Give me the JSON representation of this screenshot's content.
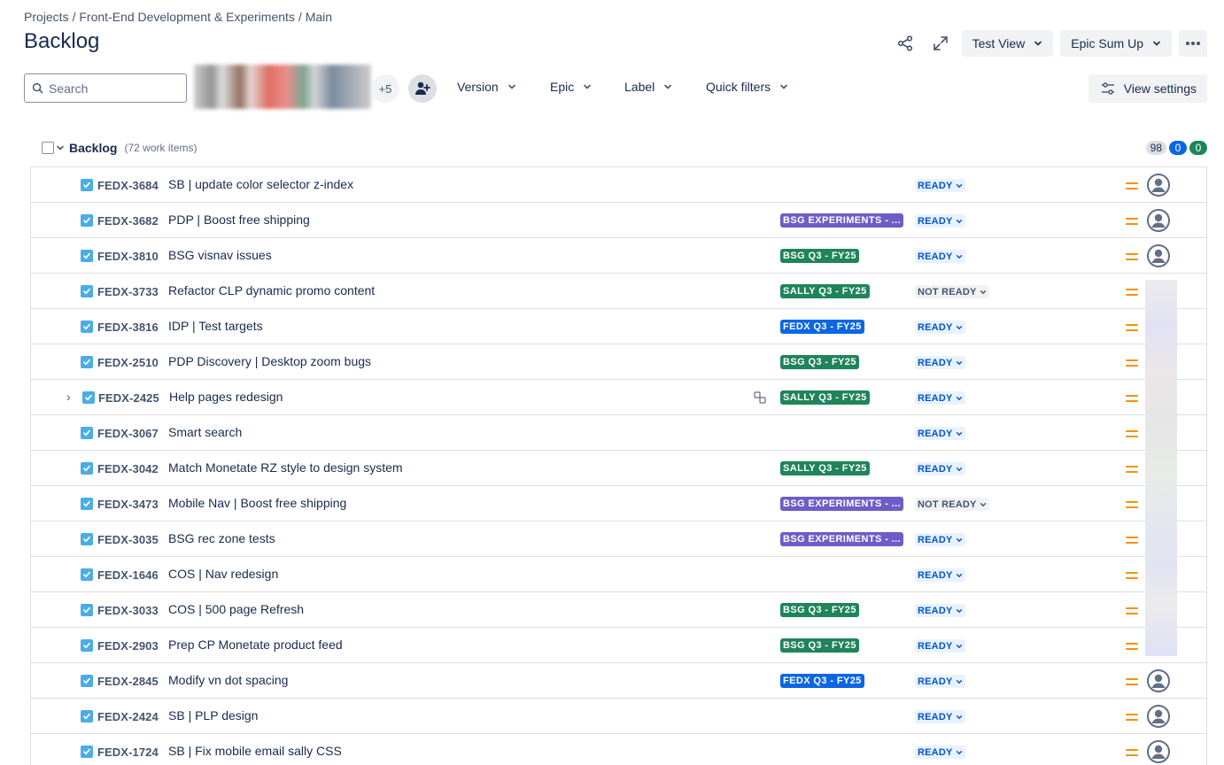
{
  "breadcrumb": [
    "Projects",
    "/ Front-End Development & Experiments",
    "/ Main"
  ],
  "title": "Backlog",
  "header": {
    "test_view": "Test View",
    "epic_sum_up": "Epic Sum Up"
  },
  "search": {
    "placeholder": "Search"
  },
  "extra_people": "+5",
  "filters": [
    "Version",
    "Epic",
    "Label",
    "Quick filters"
  ],
  "view_settings": "View settings",
  "backlog": {
    "label": "Backlog",
    "count_text": "(72 work items)",
    "counts": [
      "98",
      "0",
      "0"
    ]
  },
  "colors": {
    "purple": "#6e5dc6",
    "green": "#1f845a",
    "blue": "#0c66e4",
    "priority": "#f79009"
  },
  "rows": [
    {
      "key": "FEDX-3684",
      "summary": "SB | update color selector z-index",
      "epic": "",
      "epic_color": "",
      "status": "READY",
      "expandable": false,
      "has_children": false,
      "avatar": "person"
    },
    {
      "key": "FEDX-3682",
      "summary": "PDP | Boost free shipping",
      "epic": "BSG EXPERIMENTS - ...",
      "epic_color": "purple",
      "status": "READY",
      "expandable": false,
      "has_children": false,
      "avatar": "person"
    },
    {
      "key": "FEDX-3810",
      "summary": "BSG visnav issues",
      "epic": "BSG Q3 - FY25",
      "epic_color": "green",
      "status": "READY",
      "expandable": false,
      "has_children": false,
      "avatar": "person"
    },
    {
      "key": "FEDX-3733",
      "summary": "Refactor CLP dynamic promo content",
      "epic": "SALLY Q3 - FY25",
      "epic_color": "green",
      "status": "NOT READY",
      "expandable": false,
      "has_children": false,
      "avatar": "blurred"
    },
    {
      "key": "FEDX-3816",
      "summary": "IDP | Test targets",
      "epic": "FEDX Q3 - FY25",
      "epic_color": "blue",
      "status": "READY",
      "expandable": false,
      "has_children": false,
      "avatar": "blurred"
    },
    {
      "key": "FEDX-2510",
      "summary": "PDP Discovery | Desktop zoom bugs",
      "epic": "BSG Q3 - FY25",
      "epic_color": "green",
      "status": "READY",
      "expandable": false,
      "has_children": false,
      "avatar": "blurred"
    },
    {
      "key": "FEDX-2425",
      "summary": "Help pages redesign",
      "epic": "SALLY Q3 - FY25",
      "epic_color": "green",
      "status": "READY",
      "expandable": true,
      "has_children": true,
      "avatar": "blurred"
    },
    {
      "key": "FEDX-3067",
      "summary": "Smart search",
      "epic": "",
      "epic_color": "",
      "status": "READY",
      "expandable": false,
      "has_children": false,
      "avatar": "blurred"
    },
    {
      "key": "FEDX-3042",
      "summary": "Match Monetate RZ style to design system",
      "epic": "SALLY Q3 - FY25",
      "epic_color": "green",
      "status": "READY",
      "expandable": false,
      "has_children": false,
      "avatar": "blurred"
    },
    {
      "key": "FEDX-3473",
      "summary": "Mobile Nav | Boost free shipping",
      "epic": "BSG EXPERIMENTS - ...",
      "epic_color": "purple",
      "status": "NOT READY",
      "expandable": false,
      "has_children": false,
      "avatar": "blurred"
    },
    {
      "key": "FEDX-3035",
      "summary": "BSG rec zone tests",
      "epic": "BSG EXPERIMENTS - ...",
      "epic_color": "purple",
      "status": "READY",
      "expandable": false,
      "has_children": false,
      "avatar": "blurred"
    },
    {
      "key": "FEDX-1646",
      "summary": "COS | Nav redesign",
      "epic": "",
      "epic_color": "",
      "status": "READY",
      "expandable": false,
      "has_children": false,
      "avatar": "blurred"
    },
    {
      "key": "FEDX-3033",
      "summary": "COS | 500 page Refresh",
      "epic": "BSG Q3 - FY25",
      "epic_color": "green",
      "status": "READY",
      "expandable": false,
      "has_children": false,
      "avatar": "blurred"
    },
    {
      "key": "FEDX-2903",
      "summary": "Prep CP Monetate product feed",
      "epic": "BSG Q3 - FY25",
      "epic_color": "green",
      "status": "READY",
      "expandable": false,
      "has_children": false,
      "avatar": "blurred"
    },
    {
      "key": "FEDX-2845",
      "summary": "Modify vn dot spacing",
      "epic": "FEDX Q3 - FY25",
      "epic_color": "blue",
      "status": "READY",
      "expandable": false,
      "has_children": false,
      "avatar": "person"
    },
    {
      "key": "FEDX-2424",
      "summary": "SB | PLP design",
      "epic": "",
      "epic_color": "",
      "status": "READY",
      "expandable": false,
      "has_children": false,
      "avatar": "person"
    },
    {
      "key": "FEDX-1724",
      "summary": "SB | Fix mobile email sally CSS",
      "epic": "",
      "epic_color": "",
      "status": "READY",
      "expandable": false,
      "has_children": false,
      "avatar": "person"
    }
  ]
}
